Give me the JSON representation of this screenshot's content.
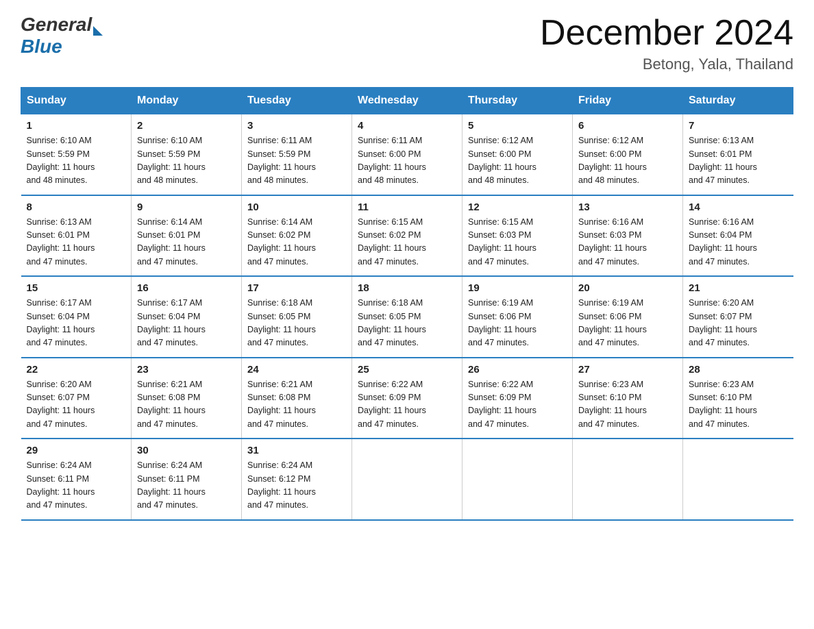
{
  "header": {
    "logo_general": "General",
    "logo_blue": "Blue",
    "month_title": "December 2024",
    "location": "Betong, Yala, Thailand"
  },
  "days_of_week": [
    "Sunday",
    "Monday",
    "Tuesday",
    "Wednesday",
    "Thursday",
    "Friday",
    "Saturday"
  ],
  "weeks": [
    [
      {
        "day": "1",
        "sunrise": "6:10 AM",
        "sunset": "5:59 PM",
        "daylight": "11 hours and 48 minutes."
      },
      {
        "day": "2",
        "sunrise": "6:10 AM",
        "sunset": "5:59 PM",
        "daylight": "11 hours and 48 minutes."
      },
      {
        "day": "3",
        "sunrise": "6:11 AM",
        "sunset": "5:59 PM",
        "daylight": "11 hours and 48 minutes."
      },
      {
        "day": "4",
        "sunrise": "6:11 AM",
        "sunset": "6:00 PM",
        "daylight": "11 hours and 48 minutes."
      },
      {
        "day": "5",
        "sunrise": "6:12 AM",
        "sunset": "6:00 PM",
        "daylight": "11 hours and 48 minutes."
      },
      {
        "day": "6",
        "sunrise": "6:12 AM",
        "sunset": "6:00 PM",
        "daylight": "11 hours and 48 minutes."
      },
      {
        "day": "7",
        "sunrise": "6:13 AM",
        "sunset": "6:01 PM",
        "daylight": "11 hours and 47 minutes."
      }
    ],
    [
      {
        "day": "8",
        "sunrise": "6:13 AM",
        "sunset": "6:01 PM",
        "daylight": "11 hours and 47 minutes."
      },
      {
        "day": "9",
        "sunrise": "6:14 AM",
        "sunset": "6:01 PM",
        "daylight": "11 hours and 47 minutes."
      },
      {
        "day": "10",
        "sunrise": "6:14 AM",
        "sunset": "6:02 PM",
        "daylight": "11 hours and 47 minutes."
      },
      {
        "day": "11",
        "sunrise": "6:15 AM",
        "sunset": "6:02 PM",
        "daylight": "11 hours and 47 minutes."
      },
      {
        "day": "12",
        "sunrise": "6:15 AM",
        "sunset": "6:03 PM",
        "daylight": "11 hours and 47 minutes."
      },
      {
        "day": "13",
        "sunrise": "6:16 AM",
        "sunset": "6:03 PM",
        "daylight": "11 hours and 47 minutes."
      },
      {
        "day": "14",
        "sunrise": "6:16 AM",
        "sunset": "6:04 PM",
        "daylight": "11 hours and 47 minutes."
      }
    ],
    [
      {
        "day": "15",
        "sunrise": "6:17 AM",
        "sunset": "6:04 PM",
        "daylight": "11 hours and 47 minutes."
      },
      {
        "day": "16",
        "sunrise": "6:17 AM",
        "sunset": "6:04 PM",
        "daylight": "11 hours and 47 minutes."
      },
      {
        "day": "17",
        "sunrise": "6:18 AM",
        "sunset": "6:05 PM",
        "daylight": "11 hours and 47 minutes."
      },
      {
        "day": "18",
        "sunrise": "6:18 AM",
        "sunset": "6:05 PM",
        "daylight": "11 hours and 47 minutes."
      },
      {
        "day": "19",
        "sunrise": "6:19 AM",
        "sunset": "6:06 PM",
        "daylight": "11 hours and 47 minutes."
      },
      {
        "day": "20",
        "sunrise": "6:19 AM",
        "sunset": "6:06 PM",
        "daylight": "11 hours and 47 minutes."
      },
      {
        "day": "21",
        "sunrise": "6:20 AM",
        "sunset": "6:07 PM",
        "daylight": "11 hours and 47 minutes."
      }
    ],
    [
      {
        "day": "22",
        "sunrise": "6:20 AM",
        "sunset": "6:07 PM",
        "daylight": "11 hours and 47 minutes."
      },
      {
        "day": "23",
        "sunrise": "6:21 AM",
        "sunset": "6:08 PM",
        "daylight": "11 hours and 47 minutes."
      },
      {
        "day": "24",
        "sunrise": "6:21 AM",
        "sunset": "6:08 PM",
        "daylight": "11 hours and 47 minutes."
      },
      {
        "day": "25",
        "sunrise": "6:22 AM",
        "sunset": "6:09 PM",
        "daylight": "11 hours and 47 minutes."
      },
      {
        "day": "26",
        "sunrise": "6:22 AM",
        "sunset": "6:09 PM",
        "daylight": "11 hours and 47 minutes."
      },
      {
        "day": "27",
        "sunrise": "6:23 AM",
        "sunset": "6:10 PM",
        "daylight": "11 hours and 47 minutes."
      },
      {
        "day": "28",
        "sunrise": "6:23 AM",
        "sunset": "6:10 PM",
        "daylight": "11 hours and 47 minutes."
      }
    ],
    [
      {
        "day": "29",
        "sunrise": "6:24 AM",
        "sunset": "6:11 PM",
        "daylight": "11 hours and 47 minutes."
      },
      {
        "day": "30",
        "sunrise": "6:24 AM",
        "sunset": "6:11 PM",
        "daylight": "11 hours and 47 minutes."
      },
      {
        "day": "31",
        "sunrise": "6:24 AM",
        "sunset": "6:12 PM",
        "daylight": "11 hours and 47 minutes."
      },
      null,
      null,
      null,
      null
    ]
  ],
  "labels": {
    "sunrise": "Sunrise:",
    "sunset": "Sunset:",
    "daylight": "Daylight:"
  }
}
